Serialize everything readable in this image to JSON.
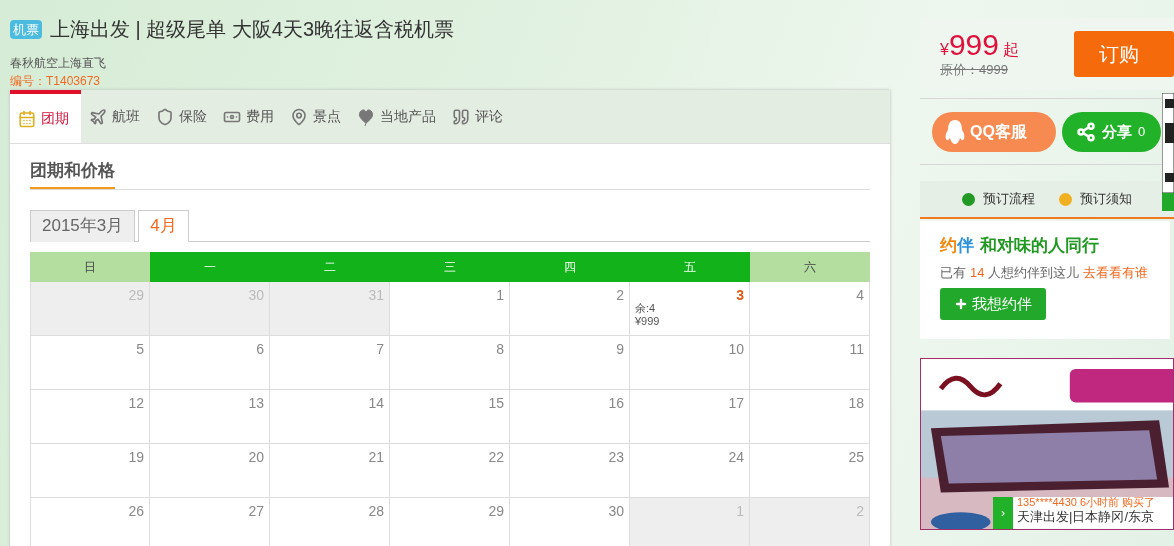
{
  "header": {
    "badge": "机票",
    "title": "上海出发 | 超级尾单 大阪4天3晚往返含税机票",
    "subtitle": "春秋航空上海直飞",
    "code": "编号：T1403673"
  },
  "tabs": [
    {
      "label": "团期",
      "selected": true
    },
    {
      "label": "航班",
      "selected": false
    },
    {
      "label": "保险",
      "selected": false
    },
    {
      "label": "费用",
      "selected": false
    },
    {
      "label": "景点",
      "selected": false
    },
    {
      "label": "当地产品",
      "selected": false
    },
    {
      "label": "评论",
      "selected": false
    }
  ],
  "section_title": "团期和价格",
  "month_tabs": [
    {
      "label": "2015年3月",
      "selected": false
    },
    {
      "label": "4月",
      "selected": true
    }
  ],
  "calendar": {
    "weekdays": [
      {
        "label": "日",
        "weekend": true
      },
      {
        "label": "一",
        "weekend": false
      },
      {
        "label": "二",
        "weekend": false
      },
      {
        "label": "三",
        "weekend": false
      },
      {
        "label": "四",
        "weekend": false
      },
      {
        "label": "五",
        "weekend": false
      },
      {
        "label": "六",
        "weekend": true
      }
    ],
    "weeks": [
      [
        {
          "day": "29",
          "kind": "other"
        },
        {
          "day": "30",
          "kind": "other"
        },
        {
          "day": "31",
          "kind": "other"
        },
        {
          "day": "1",
          "kind": "day"
        },
        {
          "day": "2",
          "kind": "day"
        },
        {
          "day": "3",
          "kind": "available",
          "seats": "余:4",
          "price": "¥999"
        },
        {
          "day": "4",
          "kind": "day"
        }
      ],
      [
        {
          "day": "5",
          "kind": "day"
        },
        {
          "day": "6",
          "kind": "day"
        },
        {
          "day": "7",
          "kind": "day"
        },
        {
          "day": "8",
          "kind": "day"
        },
        {
          "day": "9",
          "kind": "day"
        },
        {
          "day": "10",
          "kind": "day"
        },
        {
          "day": "11",
          "kind": "day"
        }
      ],
      [
        {
          "day": "12",
          "kind": "day"
        },
        {
          "day": "13",
          "kind": "day"
        },
        {
          "day": "14",
          "kind": "day"
        },
        {
          "day": "15",
          "kind": "day"
        },
        {
          "day": "16",
          "kind": "day"
        },
        {
          "day": "17",
          "kind": "day"
        },
        {
          "day": "18",
          "kind": "day"
        }
      ],
      [
        {
          "day": "19",
          "kind": "day"
        },
        {
          "day": "20",
          "kind": "day"
        },
        {
          "day": "21",
          "kind": "day"
        },
        {
          "day": "22",
          "kind": "day"
        },
        {
          "day": "23",
          "kind": "day"
        },
        {
          "day": "24",
          "kind": "day"
        },
        {
          "day": "25",
          "kind": "day"
        }
      ],
      [
        {
          "day": "26",
          "kind": "day"
        },
        {
          "day": "27",
          "kind": "day"
        },
        {
          "day": "28",
          "kind": "day"
        },
        {
          "day": "29",
          "kind": "day"
        },
        {
          "day": "30",
          "kind": "day"
        },
        {
          "day": "1",
          "kind": "other"
        },
        {
          "day": "2",
          "kind": "other"
        }
      ]
    ]
  },
  "price": {
    "currency": "¥",
    "amount": "999",
    "suffix": "起",
    "original": "原价：4999"
  },
  "order_button": "订购",
  "qq_button": "QQ客服",
  "share_button": {
    "label": "分享",
    "count": "0"
  },
  "info_links": [
    {
      "label": "预订流程",
      "kind": "info"
    },
    {
      "label": "预订须知",
      "kind": "notice"
    }
  ],
  "companion": {
    "logo_a": "约",
    "logo_b": "伴",
    "title": "和对味的人同行",
    "text_before": "已有",
    "count": "14",
    "text_after": "人想约伴到这儿",
    "link": "去看看有谁",
    "button": "我想约伴"
  },
  "toast": {
    "arrow": "›",
    "line1": "135****4430 6小时前 购买了",
    "line2": "天津出发|日本静冈/东京"
  }
}
